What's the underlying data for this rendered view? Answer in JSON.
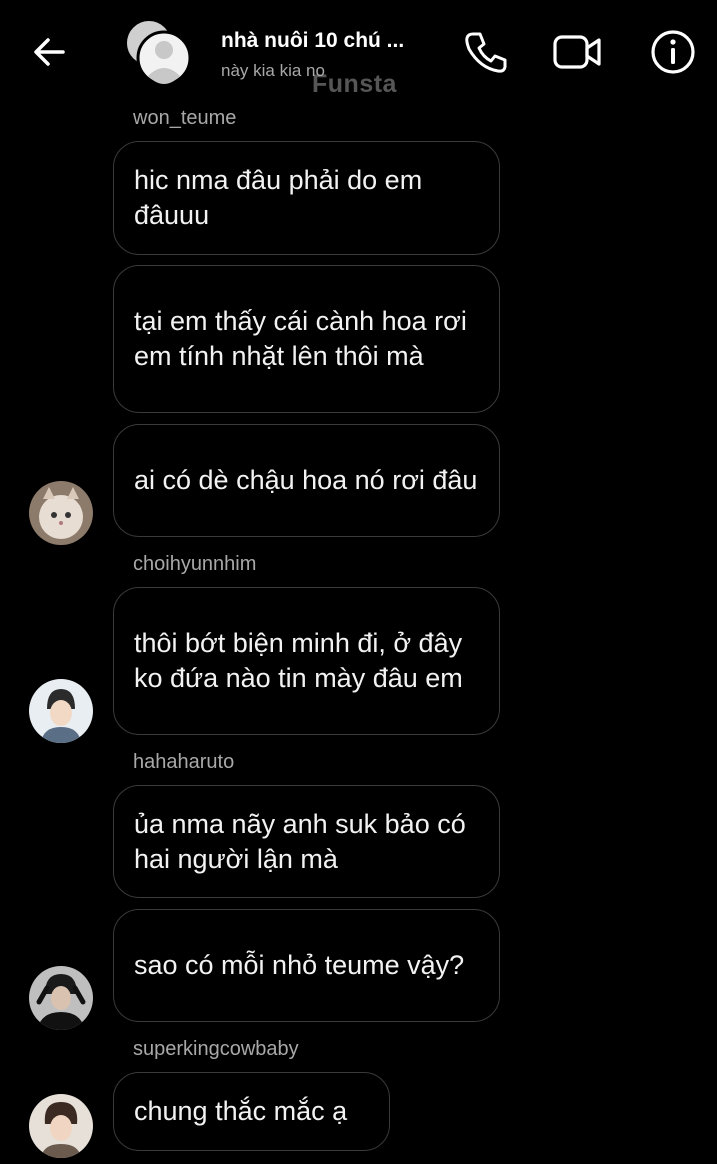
{
  "header": {
    "title": "nhà nuôi 10 chú ...",
    "subtitle": "này kia kia no",
    "watermark": "Funsta",
    "back_icon": "arrow-left-icon",
    "call_icon": "phone-icon",
    "video_icon": "video-camera-icon",
    "info_icon": "info-icon"
  },
  "messages": [
    {
      "sender": "won_teume",
      "bubbles": [
        "hic nma đâu phải do em đâuuu",
        "tại em thấy cái cành hoa rơi em tính nhặt lên thôi mà",
        "ai có dè chậu hoa nó rơi đâu"
      ]
    },
    {
      "sender": "choihyunnhim",
      "bubbles": [
        "thôi bớt biện minh đi, ở đây ko đứa nào tin mày đâu em"
      ]
    },
    {
      "sender": "hahaharuto",
      "bubbles": [
        "ủa nma nãy anh suk bảo có hai người lận mà",
        "sao có mỗi nhỏ teume vậy?"
      ]
    },
    {
      "sender": "superkingcowbaby",
      "bubbles": [
        "chung thắc mắc ạ"
      ]
    }
  ],
  "colors": {
    "background": "#000000",
    "bubble_border": "#3a3a3a",
    "secondary_text": "#a8a8a8"
  }
}
